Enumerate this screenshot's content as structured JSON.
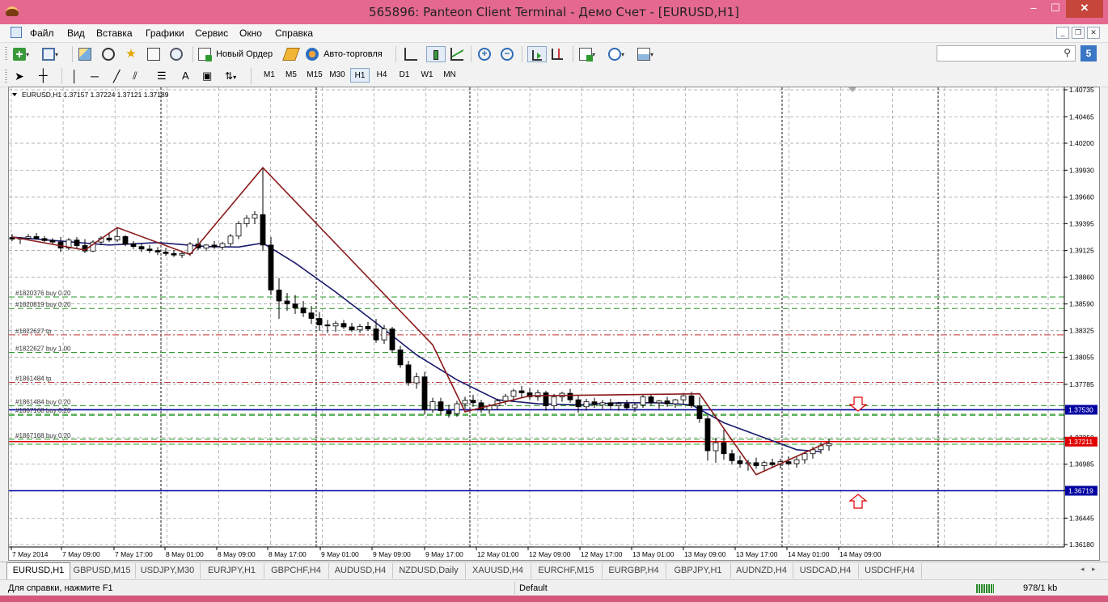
{
  "window": {
    "title": "565896: Panteon Client Terminal - Демо Счет - [EURUSD,H1]",
    "min": "–",
    "max": "☐",
    "close": "✕"
  },
  "menu": {
    "items": [
      "Файл",
      "Вид",
      "Вставка",
      "Графики",
      "Сервис",
      "Окно",
      "Справка"
    ],
    "mdi_min": "_",
    "mdi_restore": "❐",
    "mdi_close": "✕"
  },
  "toolbar": {
    "new_order": "Новый Ордер",
    "autotrade": "Авто-торговля"
  },
  "drawing_toolbar": {
    "text_tool": "A",
    "timeframes": [
      "M1",
      "M5",
      "M15",
      "M30",
      "H1",
      "H4",
      "D1",
      "W1",
      "MN"
    ],
    "active_timeframe": "H1"
  },
  "search": {
    "placeholder": "",
    "badge": "5"
  },
  "chart_data": {
    "type": "candlestick",
    "symbol_header": "EURUSD,H1  1.37157 1.37224 1.37121 1.37189",
    "ylim": [
      1.3618,
      1.40735
    ],
    "y_ticks": [
      "1.40735",
      "1.40465",
      "1.40200",
      "1.39930",
      "1.39660",
      "1.39395",
      "1.39125",
      "1.38860",
      "1.38590",
      "1.38325",
      "1.38055",
      "1.37785",
      "1.37530",
      "1.37250",
      "1.36985",
      "1.36719",
      "1.36445",
      "1.36180"
    ],
    "x_ticks": [
      "7 May 2014",
      "7 May 09:00",
      "7 May 17:00",
      "8 May 01:00",
      "8 May 09:00",
      "8 May 17:00",
      "9 May 01:00",
      "9 May 09:00",
      "9 May 17:00",
      "12 May 01:00",
      "12 May 09:00",
      "12 May 17:00",
      "13 May 01:00",
      "13 May 09:00",
      "13 May 17:00",
      "14 May 01:00",
      "14 May 09:00"
    ],
    "bid_price": "1.37211",
    "marked_levels": [
      {
        "label": "1.37530",
        "value": 1.3753,
        "color": "#0000a0"
      },
      {
        "label": "1.37211",
        "value": 1.37211,
        "color": "#e00000"
      },
      {
        "label": "1.36719",
        "value": 1.36719,
        "color": "#0000a0"
      }
    ],
    "order_lines": [
      {
        "label": "#1820376 buy 0.20",
        "value": 1.3866,
        "color": "#2a9a2a",
        "style": "dash"
      },
      {
        "label": "#1820819 buy 0.20",
        "value": 1.38545,
        "color": "#2a9a2a",
        "style": "dash"
      },
      {
        "label": "#1822627 tp",
        "value": 1.3828,
        "color": "#c03030",
        "style": "dashdot"
      },
      {
        "label": "#1822627 buy 1.00",
        "value": 1.38105,
        "color": "#2a9a2a",
        "style": "dash"
      },
      {
        "label": "#1861484 tp",
        "value": 1.37805,
        "color": "#c03030",
        "style": "dashdot"
      },
      {
        "label": "#1861484 buy 0.20",
        "value": 1.3757,
        "color": "#2a9a2a",
        "style": "dash"
      },
      {
        "label": "#1867168 buy 0.20",
        "value": 1.37485,
        "color": "#2a9a2a",
        "style": "dash"
      },
      {
        "label": "#1867168 buy 0.20",
        "value": 1.37235,
        "color": "#2a9a2a",
        "style": "dash"
      }
    ],
    "extra_lines": [
      {
        "value": 1.37475,
        "color": "#2a9a2a",
        "style": "dash"
      },
      {
        "value": 1.37185,
        "color": "#2a9a2a",
        "style": "dash"
      }
    ],
    "zigzag": [
      [
        0,
        1.3926
      ],
      [
        9,
        1.3913
      ],
      [
        13,
        1.39355
      ],
      [
        22,
        1.39085
      ],
      [
        31,
        1.39955
      ],
      [
        52,
        1.3818
      ],
      [
        56,
        1.3751
      ],
      [
        64,
        1.3767
      ],
      [
        85,
        1.3769
      ],
      [
        92,
        1.3688
      ],
      [
        101,
        1.3721
      ]
    ],
    "moving_average": [
      [
        0,
        1.3926
      ],
      [
        6,
        1.3922
      ],
      [
        12,
        1.3918
      ],
      [
        18,
        1.39205
      ],
      [
        24,
        1.39165
      ],
      [
        28,
        1.3916
      ],
      [
        31,
        1.392
      ],
      [
        35,
        1.39
      ],
      [
        40,
        1.3871
      ],
      [
        45,
        1.384
      ],
      [
        50,
        1.3808
      ],
      [
        55,
        1.3783
      ],
      [
        60,
        1.3763
      ],
      [
        65,
        1.3759
      ],
      [
        70,
        1.3758
      ],
      [
        75,
        1.376
      ],
      [
        80,
        1.376
      ],
      [
        84,
        1.3758
      ],
      [
        88,
        1.374
      ],
      [
        93,
        1.3725
      ],
      [
        97,
        1.3713
      ],
      [
        100,
        1.3711
      ]
    ],
    "candles": [
      [
        1.39255,
        1.3929,
        1.3922,
        1.3924
      ],
      [
        1.3924,
        1.3926,
        1.3919,
        1.3925
      ],
      [
        1.3925,
        1.3929,
        1.3923,
        1.39265
      ],
      [
        1.39265,
        1.393,
        1.3924,
        1.39245
      ],
      [
        1.39245,
        1.3927,
        1.3921,
        1.39225
      ],
      [
        1.39225,
        1.3925,
        1.3919,
        1.3921
      ],
      [
        1.3921,
        1.3926,
        1.3911,
        1.3915
      ],
      [
        1.3915,
        1.3925,
        1.3913,
        1.3923
      ],
      [
        1.3923,
        1.3926,
        1.3914,
        1.39175
      ],
      [
        1.39175,
        1.3924,
        1.391,
        1.3912
      ],
      [
        1.3912,
        1.3923,
        1.3911,
        1.3921
      ],
      [
        1.3921,
        1.3927,
        1.3918,
        1.3925
      ],
      [
        1.3925,
        1.393,
        1.3921,
        1.3923
      ],
      [
        1.3923,
        1.3935,
        1.3921,
        1.39265
      ],
      [
        1.39265,
        1.3928,
        1.3917,
        1.3919
      ],
      [
        1.3919,
        1.3922,
        1.3914,
        1.39165
      ],
      [
        1.39165,
        1.3919,
        1.3911,
        1.3914
      ],
      [
        1.3914,
        1.3918,
        1.391,
        1.39125
      ],
      [
        1.39125,
        1.3916,
        1.3908,
        1.3911
      ],
      [
        1.3911,
        1.3915,
        1.3907,
        1.39095
      ],
      [
        1.39095,
        1.3913,
        1.3906,
        1.3908
      ],
      [
        1.3908,
        1.3911,
        1.3905,
        1.39095
      ],
      [
        1.39095,
        1.3921,
        1.3907,
        1.3919
      ],
      [
        1.3919,
        1.3925,
        1.3913,
        1.3915
      ],
      [
        1.3915,
        1.3919,
        1.3912,
        1.3918
      ],
      [
        1.3918,
        1.3922,
        1.3914,
        1.3916
      ],
      [
        1.3916,
        1.3921,
        1.3913,
        1.39195
      ],
      [
        1.39195,
        1.3929,
        1.3917,
        1.3927
      ],
      [
        1.3927,
        1.3942,
        1.3924,
        1.39395
      ],
      [
        1.39395,
        1.3948,
        1.3936,
        1.3945
      ],
      [
        1.3945,
        1.3952,
        1.3939,
        1.39485
      ],
      [
        1.39485,
        1.39955,
        1.3912,
        1.3918
      ],
      [
        1.3918,
        1.3926,
        1.3868,
        1.3873
      ],
      [
        1.3873,
        1.3885,
        1.3844,
        1.3862
      ],
      [
        1.3862,
        1.387,
        1.3852,
        1.3859
      ],
      [
        1.3859,
        1.3868,
        1.3849,
        1.3855
      ],
      [
        1.3855,
        1.3862,
        1.3846,
        1.385
      ],
      [
        1.385,
        1.3857,
        1.3839,
        1.38445
      ],
      [
        1.38445,
        1.3851,
        1.3832,
        1.3838
      ],
      [
        1.3838,
        1.3843,
        1.383,
        1.3837
      ],
      [
        1.3837,
        1.3842,
        1.3831,
        1.38395
      ],
      [
        1.38395,
        1.3843,
        1.3834,
        1.3836
      ],
      [
        1.3836,
        1.384,
        1.3831,
        1.3833
      ],
      [
        1.3833,
        1.3839,
        1.383,
        1.38365
      ],
      [
        1.38365,
        1.3841,
        1.3832,
        1.3834
      ],
      [
        1.3834,
        1.3844,
        1.382,
        1.3823
      ],
      [
        1.3823,
        1.3838,
        1.3819,
        1.3834
      ],
      [
        1.3834,
        1.3836,
        1.381,
        1.3813
      ],
      [
        1.3813,
        1.3817,
        1.3795,
        1.3798
      ],
      [
        1.3798,
        1.3802,
        1.3777,
        1.378
      ],
      [
        1.378,
        1.379,
        1.3774,
        1.3786
      ],
      [
        1.3786,
        1.3791,
        1.3748,
        1.3753
      ],
      [
        1.3753,
        1.3765,
        1.375,
        1.3761
      ],
      [
        1.3761,
        1.3765,
        1.3748,
        1.3752
      ],
      [
        1.3752,
        1.3758,
        1.3745,
        1.3749
      ],
      [
        1.3749,
        1.3762,
        1.3746,
        1.3759
      ],
      [
        1.3759,
        1.3766,
        1.3754,
        1.37625
      ],
      [
        1.37625,
        1.3768,
        1.3756,
        1.376
      ],
      [
        1.376,
        1.3763,
        1.375,
        1.3753
      ],
      [
        1.3753,
        1.3759,
        1.3749,
        1.3757
      ],
      [
        1.3757,
        1.3764,
        1.3753,
        1.3762
      ],
      [
        1.3762,
        1.3769,
        1.3758,
        1.37665
      ],
      [
        1.37665,
        1.3774,
        1.3761,
        1.3772
      ],
      [
        1.3772,
        1.3777,
        1.3765,
        1.377
      ],
      [
        1.377,
        1.3775,
        1.3763,
        1.3766
      ],
      [
        1.3766,
        1.3773,
        1.3762,
        1.377
      ],
      [
        1.377,
        1.3772,
        1.3752,
        1.3757
      ],
      [
        1.3757,
        1.3769,
        1.3753,
        1.3766
      ],
      [
        1.3766,
        1.3771,
        1.3761,
        1.37695
      ],
      [
        1.37695,
        1.3774,
        1.376,
        1.3763
      ],
      [
        1.3763,
        1.3767,
        1.375,
        1.3756
      ],
      [
        1.3756,
        1.3764,
        1.3752,
        1.3761
      ],
      [
        1.3761,
        1.3765,
        1.3755,
        1.3758
      ],
      [
        1.3758,
        1.3763,
        1.3754,
        1.376
      ],
      [
        1.376,
        1.3764,
        1.3754,
        1.3757
      ],
      [
        1.3757,
        1.3761,
        1.3752,
        1.3759
      ],
      [
        1.3759,
        1.3763,
        1.3753,
        1.3755
      ],
      [
        1.3755,
        1.376,
        1.3751,
        1.3758
      ],
      [
        1.3758,
        1.3768,
        1.3755,
        1.3766
      ],
      [
        1.3766,
        1.3769,
        1.3757,
        1.376
      ],
      [
        1.376,
        1.3763,
        1.3754,
        1.3762
      ],
      [
        1.3762,
        1.3766,
        1.3756,
        1.3759
      ],
      [
        1.3759,
        1.3764,
        1.3755,
        1.3763
      ],
      [
        1.3763,
        1.377,
        1.3758,
        1.3767
      ],
      [
        1.3767,
        1.3771,
        1.3755,
        1.3757
      ],
      [
        1.3757,
        1.3766,
        1.374,
        1.3744
      ],
      [
        1.3744,
        1.3747,
        1.3702,
        1.3712
      ],
      [
        1.3712,
        1.3725,
        1.37,
        1.372
      ],
      [
        1.372,
        1.3733,
        1.3703,
        1.3709
      ],
      [
        1.3709,
        1.3713,
        1.3698,
        1.3702
      ],
      [
        1.3702,
        1.3707,
        1.3695,
        1.3699
      ],
      [
        1.3699,
        1.3703,
        1.3692,
        1.37
      ],
      [
        1.37,
        1.3705,
        1.3694,
        1.3697
      ],
      [
        1.3697,
        1.3702,
        1.3692,
        1.37
      ],
      [
        1.37,
        1.3704,
        1.3695,
        1.3698
      ],
      [
        1.3698,
        1.3704,
        1.3694,
        1.3701
      ],
      [
        1.3701,
        1.3706,
        1.3697,
        1.3699
      ],
      [
        1.3699,
        1.3706,
        1.3695,
        1.3703
      ],
      [
        1.3703,
        1.3711,
        1.3699,
        1.3709
      ],
      [
        1.3709,
        1.3716,
        1.3704,
        1.3713
      ],
      [
        1.3713,
        1.372,
        1.3709,
        1.3717
      ],
      [
        1.3717,
        1.3724,
        1.3712,
        1.3719
      ]
    ]
  },
  "chart_tabs": {
    "items": [
      "EURUSD,H1",
      "GBPUSD,M15",
      "USDJPY,M30",
      "EURJPY,H1",
      "GBPCHF,H4",
      "AUDUSD,H4",
      "NZDUSD,Daily",
      "XAUUSD,H4",
      "EURCHF,M15",
      "EURGBP,H4",
      "GBPJPY,H1",
      "AUDNZD,H4",
      "USDCAD,H4",
      "USDCHF,H4"
    ],
    "active": 0
  },
  "status": {
    "help": "Для справки, нажмите F1",
    "profile": "Default",
    "traffic": "978/1 kb"
  }
}
